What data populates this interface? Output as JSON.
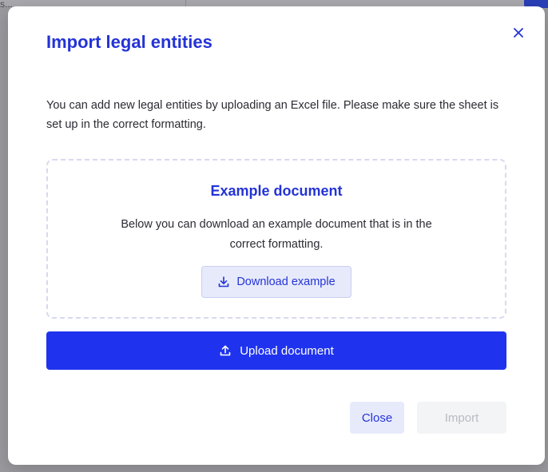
{
  "background": {
    "partial_text": "s..."
  },
  "dialog": {
    "title": "Import legal entities",
    "close_icon": "close-icon",
    "intro_text": "You can add new legal entities by uploading an Excel file. Please make sure the sheet is set up in the correct formatting.",
    "example": {
      "title": "Example document",
      "description": "Below you can download an example document that is in the correct formatting.",
      "download_label": "Download example",
      "download_icon": "download-icon"
    },
    "upload_label": "Upload document",
    "upload_icon": "upload-icon",
    "footer": {
      "close_label": "Close",
      "import_label": "Import",
      "import_disabled": true
    }
  },
  "colors": {
    "accent": "#2433d6",
    "primary_button": "#1f33ee",
    "secondary_button": "#e7eafb",
    "disabled_button": "#f3f4f6"
  }
}
